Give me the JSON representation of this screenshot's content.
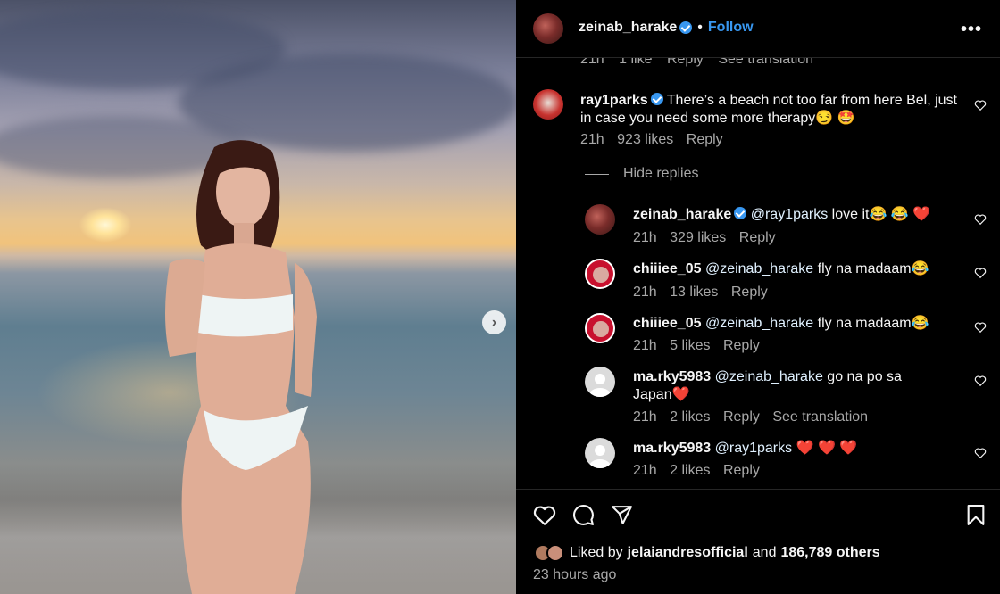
{
  "photo": {
    "carousel_next": "›"
  },
  "header": {
    "username": "zeinab_harake",
    "separator": "•",
    "follow_label": "Follow",
    "more": "•••"
  },
  "partial_row": {
    "time": "21h",
    "likes": "1 like",
    "reply": "Reply",
    "see_translation": "See translation"
  },
  "comments": [
    {
      "user": "ray1parks",
      "text": "There’s a beach not too far from here Bel, just in case you need some more therapy😏 🤩",
      "time": "21h",
      "likes": "923 likes",
      "reply": "Reply"
    }
  ],
  "hide_replies": "Hide replies",
  "replies": [
    {
      "user": "zeinab_harake",
      "mention": "@ray1parks",
      "text": " love it😂 😂 ❤️",
      "time": "21h",
      "likes": "329 likes",
      "reply": "Reply"
    },
    {
      "user": "chiiiee_05",
      "mention": "@zeinab_harake",
      "text": " fly na madaam😂",
      "time": "21h",
      "likes": "13 likes",
      "reply": "Reply"
    },
    {
      "user": "chiiiee_05",
      "mention": "@zeinab_harake",
      "text": " fly na madaam😂",
      "time": "21h",
      "likes": "5 likes",
      "reply": "Reply"
    },
    {
      "user": "ma.rky5983",
      "mention": "@zeinab_harake",
      "text": " go na po sa Japan❤️",
      "time": "21h",
      "likes": "2 likes",
      "reply": "Reply",
      "see_translation": "See translation"
    },
    {
      "user": "ma.rky5983",
      "mention": "@ray1parks",
      "text": " ❤️ ❤️ ❤️",
      "time": "21h",
      "likes": "2 likes",
      "reply": "Reply"
    }
  ],
  "footer": {
    "liked_prefix": "Liked by",
    "liked_user": "jelaiandresofficial",
    "liked_and": "and",
    "liked_others": "186,789 others",
    "time_ago": "23 hours ago"
  },
  "colors": {
    "accent": "#3897f0",
    "background": "#000000",
    "secondary_text": "#a8a8a8"
  }
}
